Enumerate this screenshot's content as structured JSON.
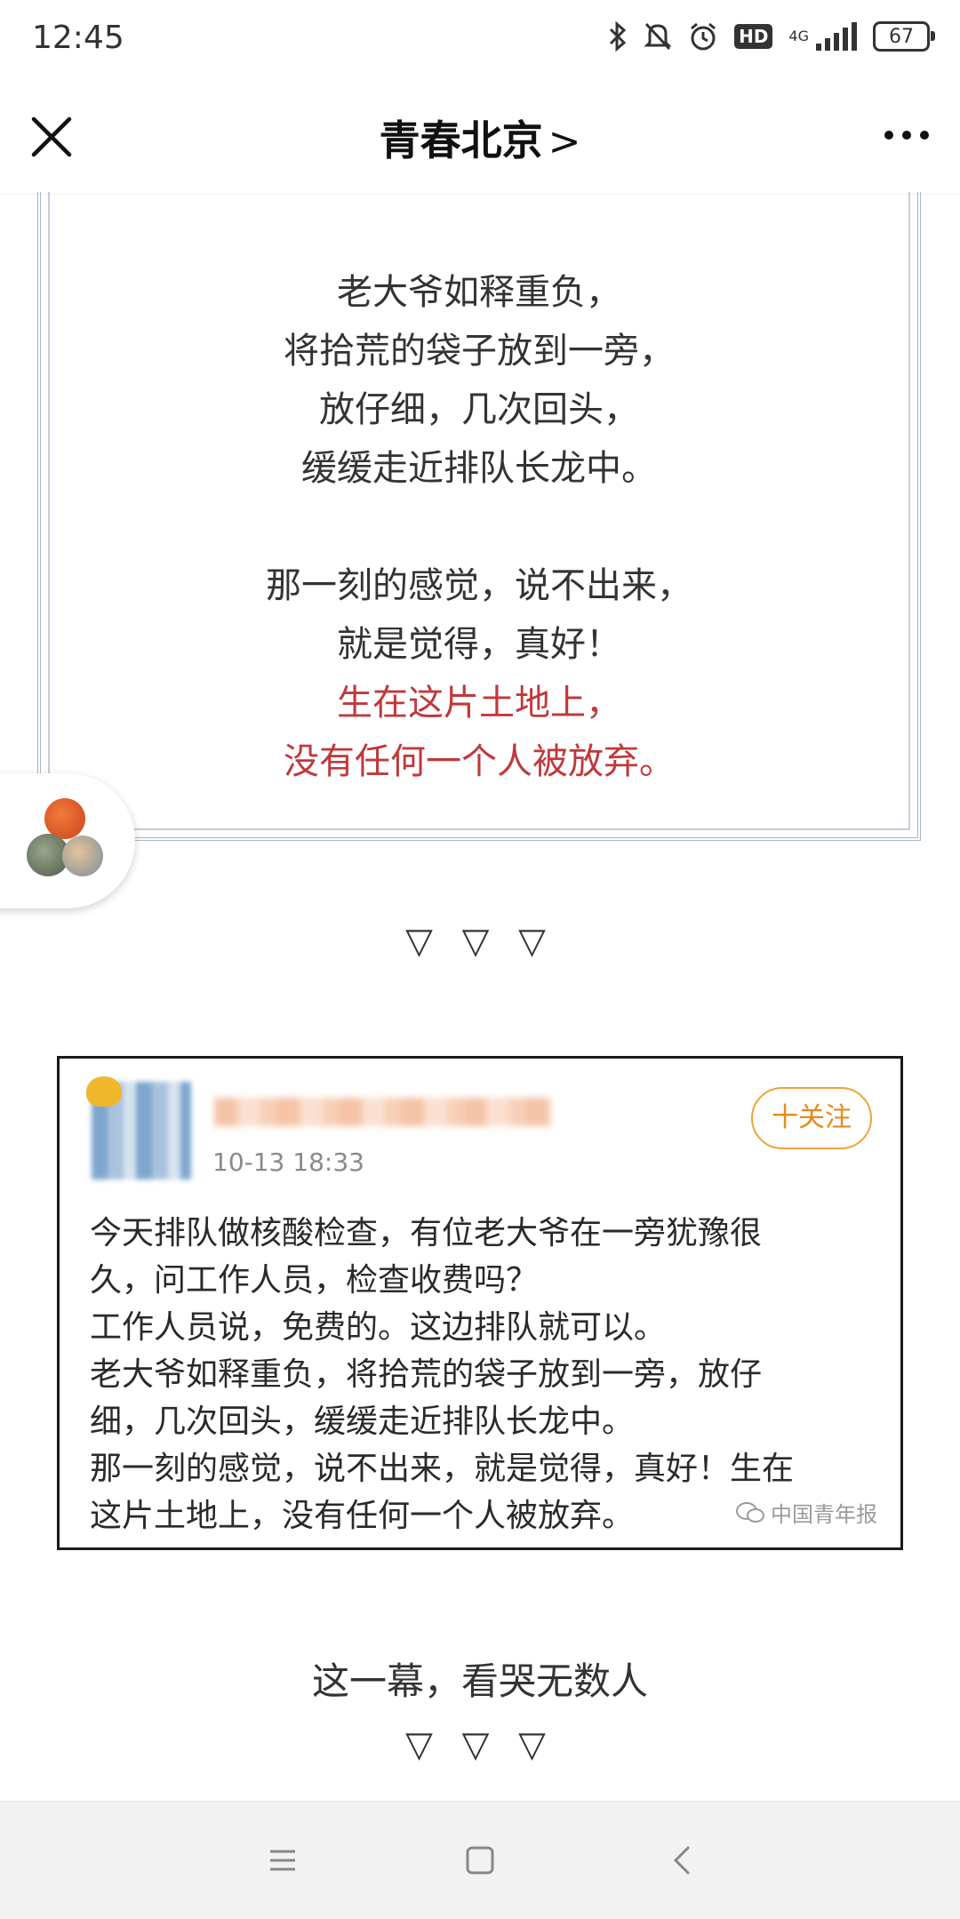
{
  "status_bar": {
    "time": "12:45",
    "network": "4G",
    "hd_label": "HD",
    "battery": "67",
    "icons": [
      "bluetooth-icon",
      "mute-bell-icon",
      "alarm-icon",
      "hd-icon",
      "signal-icon",
      "battery-icon"
    ]
  },
  "header": {
    "title": "青春北京",
    "title_chevron": ">",
    "close_icon": "close-icon",
    "more_icon": "more-icon"
  },
  "poem": {
    "stanza1": [
      "老大爷如释重负，",
      "将拾荒的袋子放到一旁，",
      "放仔细，几次回头，",
      "缓缓走近排队长龙中。"
    ],
    "stanza2": [
      "那一刻的感觉，说不出来，",
      "就是觉得，真好！"
    ],
    "highlight": [
      "生在这片土地上，",
      "没有任何一个人被放弃。"
    ],
    "highlight_color": "#c0393b"
  },
  "divider_symbols": "▽ ▽ ▽",
  "post": {
    "time": "10-13 18:33",
    "follow_label": "十关注",
    "body": [
      "今天排队做核酸检查，有位老大爷在一旁犹豫很",
      "久，问工作人员，检查收费吗？",
      "工作人员说，免费的。这边排队就可以。",
      "老大爷如释重负，将拾荒的袋子放到一旁，放仔",
      "细，几次回头，缓缓走近排队长龙中。",
      "那一刻的感觉，说不出来，就是觉得，真好！生在",
      "这片土地上，没有任何一个人被放弃。"
    ],
    "watermark": "中国青年报",
    "accent_color": "#e58a18"
  },
  "caption": "这一幕，看哭无数人",
  "caption_symbols": "▽ ▽ ▽",
  "nav": {
    "icons": [
      "menu-icon",
      "home-square-icon",
      "back-icon"
    ]
  }
}
